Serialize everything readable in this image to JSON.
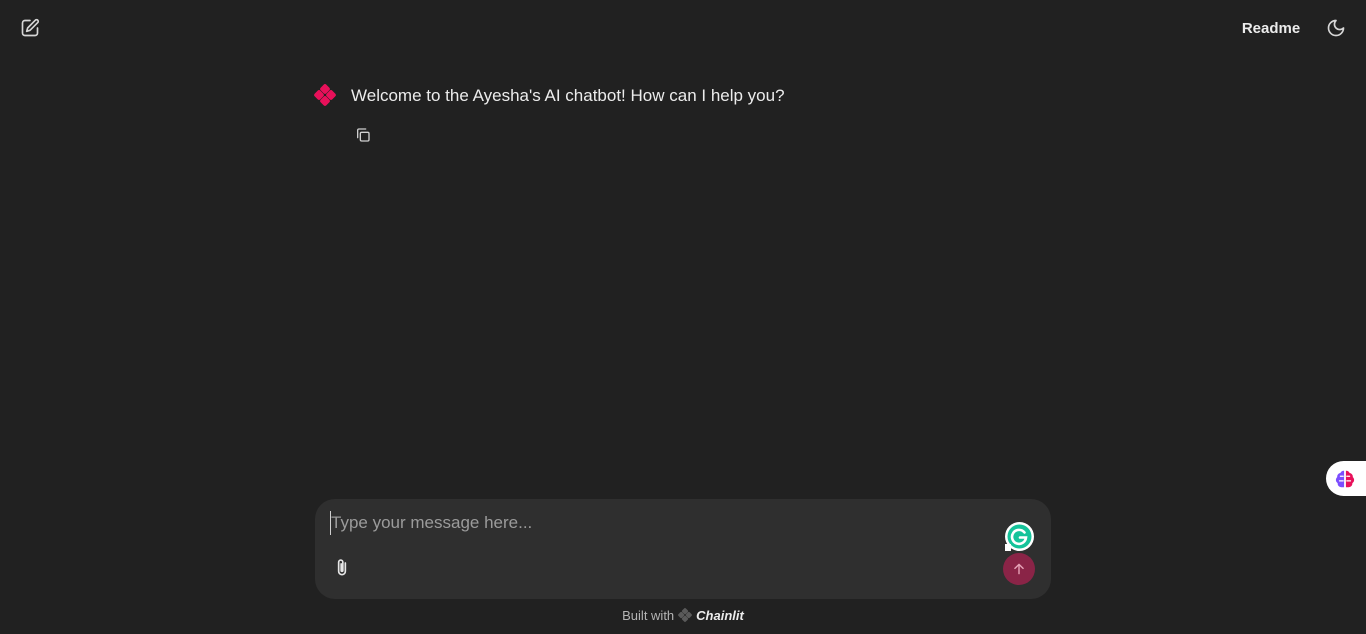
{
  "header": {
    "new_chat_icon": "edit-pencil-icon",
    "readme_label": "Readme",
    "theme_icon": "moon-icon"
  },
  "message": {
    "avatar_icon": "chainlit-logo-icon",
    "text": "Welcome to the Ayesha's AI chatbot! How can I help you?",
    "copy_icon": "copy-icon"
  },
  "composer": {
    "placeholder": "Type your message here...",
    "value": "",
    "attach_icon": "paperclip-icon",
    "send_icon": "arrow-up-icon",
    "grammarly_icon": "grammarly-icon"
  },
  "footer": {
    "built_with": "Built with",
    "brand": "Chainlit"
  },
  "side_widget": {
    "icon": "brain-icon"
  },
  "colors": {
    "background": "#212121",
    "composer_bg": "#2f2f2f",
    "accent": "#e8105a",
    "send_bg": "#8a2447"
  }
}
